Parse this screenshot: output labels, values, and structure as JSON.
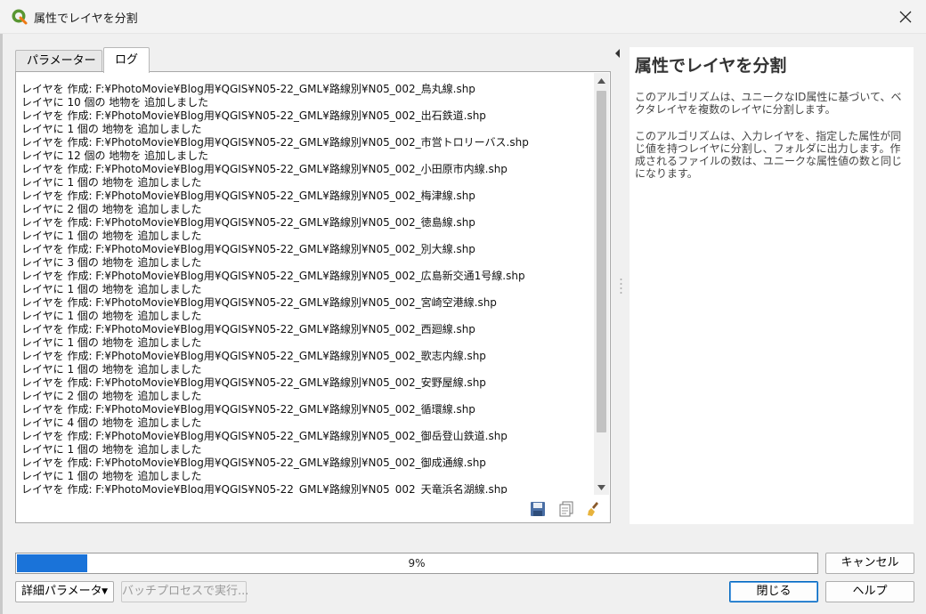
{
  "window": {
    "title": "属性でレイヤを分割",
    "close_label": "✕"
  },
  "tabs": [
    {
      "label": "パラメーター"
    },
    {
      "label": "ログ",
      "active": true
    }
  ],
  "log": {
    "lines": [
      "レイヤを 作成: F:¥PhotoMovie¥Blog用¥QGIS¥N05-22_GML¥路線別¥N05_002_鳥丸線.shp",
      "レイヤに 10 個の 地物を 追加しました",
      "レイヤを 作成: F:¥PhotoMovie¥Blog用¥QGIS¥N05-22_GML¥路線別¥N05_002_出石鉄道.shp",
      "レイヤに 1 個の 地物を 追加しました",
      "レイヤを 作成: F:¥PhotoMovie¥Blog用¥QGIS¥N05-22_GML¥路線別¥N05_002_市営トロリーバス.shp",
      "レイヤに 12 個の 地物を 追加しました",
      "レイヤを 作成: F:¥PhotoMovie¥Blog用¥QGIS¥N05-22_GML¥路線別¥N05_002_小田原市内線.shp",
      "レイヤに 1 個の 地物を 追加しました",
      "レイヤを 作成: F:¥PhotoMovie¥Blog用¥QGIS¥N05-22_GML¥路線別¥N05_002_梅津線.shp",
      "レイヤに 2 個の 地物を 追加しました",
      "レイヤを 作成: F:¥PhotoMovie¥Blog用¥QGIS¥N05-22_GML¥路線別¥N05_002_徳島線.shp",
      "レイヤに 1 個の 地物を 追加しました",
      "レイヤを 作成: F:¥PhotoMovie¥Blog用¥QGIS¥N05-22_GML¥路線別¥N05_002_別大線.shp",
      "レイヤに 3 個の 地物を 追加しました",
      "レイヤを 作成: F:¥PhotoMovie¥Blog用¥QGIS¥N05-22_GML¥路線別¥N05_002_広島新交通1号線.shp",
      "レイヤに 1 個の 地物を 追加しました",
      "レイヤを 作成: F:¥PhotoMovie¥Blog用¥QGIS¥N05-22_GML¥路線別¥N05_002_宮崎空港線.shp",
      "レイヤに 1 個の 地物を 追加しました",
      "レイヤを 作成: F:¥PhotoMovie¥Blog用¥QGIS¥N05-22_GML¥路線別¥N05_002_西廻線.shp",
      "レイヤに 1 個の 地物を 追加しました",
      "レイヤを 作成: F:¥PhotoMovie¥Blog用¥QGIS¥N05-22_GML¥路線別¥N05_002_歌志内線.shp",
      "レイヤに 1 個の 地物を 追加しました",
      "レイヤを 作成: F:¥PhotoMovie¥Blog用¥QGIS¥N05-22_GML¥路線別¥N05_002_安野屋線.shp",
      "レイヤに 2 個の 地物を 追加しました",
      "レイヤを 作成: F:¥PhotoMovie¥Blog用¥QGIS¥N05-22_GML¥路線別¥N05_002_循環線.shp",
      "レイヤに 4 個の 地物を 追加しました",
      "レイヤを 作成: F:¥PhotoMovie¥Blog用¥QGIS¥N05-22_GML¥路線別¥N05_002_御岳登山鉄道.shp",
      "レイヤに 1 個の 地物を 追加しました",
      "レイヤを 作成: F:¥PhotoMovie¥Blog用¥QGIS¥N05-22_GML¥路線別¥N05_002_御成通線.shp",
      "レイヤに 1 個の 地物を 追加しました",
      "レイヤを 作成: F:¥PhotoMovie¥Blog用¥QGIS¥N05-22_GML¥路線別¥N05_002_天竜浜名湖線.shp"
    ]
  },
  "help": {
    "title": "属性でレイヤを分割",
    "paragraphs": [
      "このアルゴリズムは、ユニークなID属性に基づいて、ベクタレイヤを複数のレイヤに分割します。",
      "このアルゴリズムは、入力レイヤを、指定した属性が同じ値を持つレイヤに分割し、フォルダに出力します。作成されるファイルの数は、ユニークな属性値の数と同じになります。"
    ]
  },
  "progress": {
    "percent": 9,
    "label": "9%",
    "fill_color": "#1a73d9"
  },
  "buttons": {
    "cancel": "キャンセル",
    "advanced": "詳細パラメータ",
    "batch": "バッチプロセスで実行...",
    "close": "閉じる",
    "help": "ヘルプ"
  },
  "icons": {
    "app": "qgis-logo-icon",
    "save": "save-log-icon",
    "copy": "copy-log-icon",
    "clear": "clear-log-icon"
  }
}
